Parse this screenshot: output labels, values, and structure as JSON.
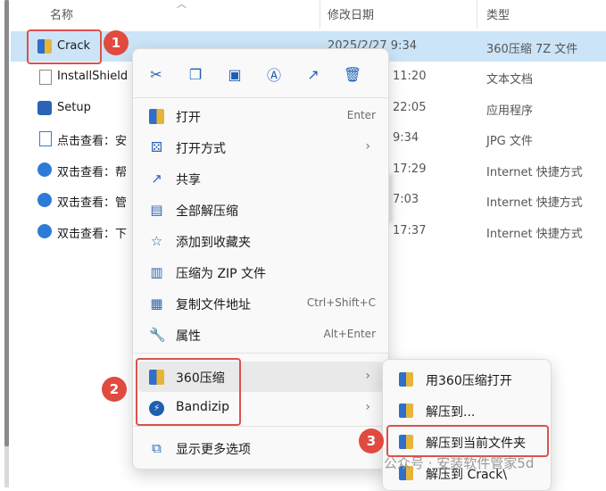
{
  "header": {
    "col_name": "名称",
    "col_date": "修改日期",
    "col_type": "类型"
  },
  "files": [
    {
      "name": "Crack",
      "date": "2025/2/27 9:34",
      "type": "360压缩 7Z 文件",
      "icon": "archive-folder-icon"
    },
    {
      "name": "InstallShield",
      "date": "11:20",
      "type": "文本文档",
      "icon": "text-file-icon"
    },
    {
      "name": "Setup",
      "date": "22:05",
      "type": "应用程序",
      "icon": "setup-app-icon"
    },
    {
      "name": "点击查看：安",
      "date": "9:34",
      "type": "JPG 文件",
      "icon": "image-file-icon"
    },
    {
      "name": "双击查看：帮",
      "date": "17:29",
      "type": "Internet 快捷方式",
      "icon": "internet-shortcut-icon"
    },
    {
      "name": "双击查看：管",
      "date": "7:03",
      "type": "Internet 快捷方式",
      "icon": "internet-shortcut-icon"
    },
    {
      "name": "双击查看：下",
      "date": "17:37",
      "type": "Internet 快捷方式",
      "icon": "internet-shortcut-icon"
    }
  ],
  "toolbar": {
    "icons": [
      "cut-icon",
      "copy-icon",
      "paste-icon",
      "rename-icon",
      "share-icon",
      "delete-icon"
    ]
  },
  "menu": {
    "items": [
      {
        "label": "打开",
        "key": "Enter",
        "icon": "open-icon"
      },
      {
        "label": "打开方式",
        "key": "",
        "icon": "open-with-icon",
        "submenu": true
      },
      {
        "label": "共享",
        "key": "",
        "icon": "share-icon"
      },
      {
        "label": "全部解压缩",
        "key": "",
        "icon": "extract-all-icon"
      },
      {
        "label": "添加到收藏夹",
        "key": "",
        "icon": "star-icon"
      },
      {
        "label": "压缩为 ZIP 文件",
        "key": "",
        "icon": "zip-icon"
      },
      {
        "label": "复制文件地址",
        "key": "Ctrl+Shift+C",
        "icon": "copy-path-icon"
      },
      {
        "label": "属性",
        "key": "Alt+Enter",
        "icon": "properties-icon"
      },
      {
        "label": "360压缩",
        "key": "",
        "icon": "360-zip-icon",
        "submenu": true
      },
      {
        "label": "Bandizip",
        "key": "",
        "icon": "bandizip-icon",
        "submenu": true
      },
      {
        "label": "显示更多选项",
        "key": "",
        "icon": "more-options-icon"
      }
    ]
  },
  "submenu": {
    "items": [
      {
        "label": "用360压缩打开"
      },
      {
        "label": "解压到..."
      },
      {
        "label": "解压到当前文件夹"
      },
      {
        "label": "解压到 Crack\\"
      }
    ]
  },
  "annotations": {
    "b1": "1",
    "b2": "2",
    "b3": "3"
  },
  "watermark": "公众号 · 安装软件管家5d",
  "colors": {
    "highlight": "#d9534f",
    "badge": "#e04a3f",
    "selection": "#cce4f7"
  }
}
